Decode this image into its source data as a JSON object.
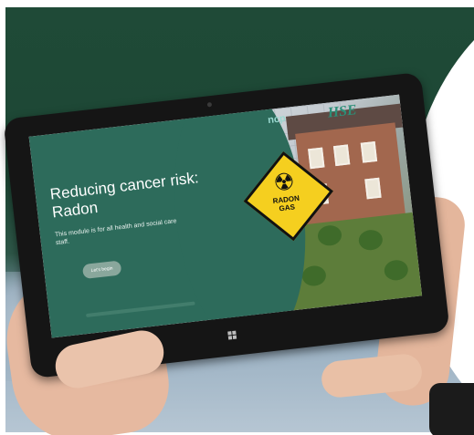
{
  "screen": {
    "title": "Reducing cancer risk: Radon",
    "subtitle": "This module is for all health and social care staff.",
    "button_label": "Let's begin",
    "sign_text": "RADON\nGAS",
    "logo_left": "ncp",
    "logo_right": "HSE"
  },
  "colors": {
    "screen_green": "#2d6b5b",
    "button": "#89a79c",
    "sign_yellow": "#f5cf1f",
    "background_green": "#1f4a37"
  },
  "icons": {
    "hazard": "radiation-icon",
    "windows": "windows-logo-icon"
  }
}
